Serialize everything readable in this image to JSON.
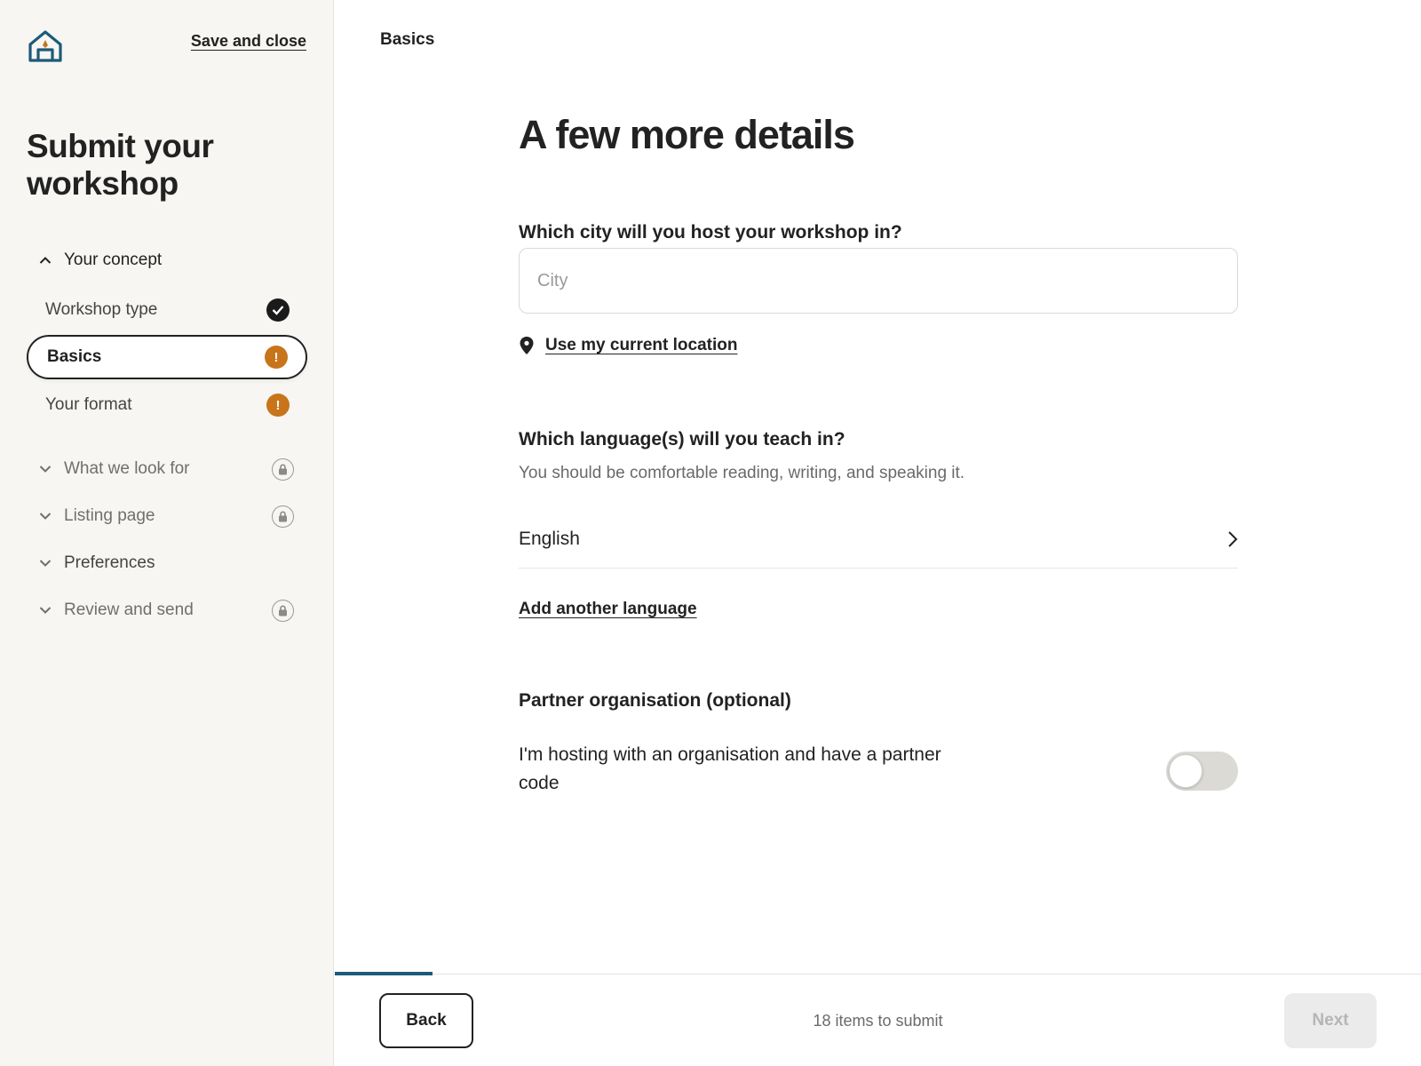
{
  "sidebar": {
    "logo_icon": "house-logo-icon",
    "save_close": "Save and close",
    "title": "Submit your workshop",
    "sections": [
      {
        "label": "Your concept",
        "state": "open"
      },
      {
        "label": "What we look for",
        "state": "locked"
      },
      {
        "label": "Listing page",
        "state": "locked"
      },
      {
        "label": "Preferences",
        "state": "collapsed"
      },
      {
        "label": "Review and send",
        "state": "locked"
      }
    ],
    "steps": [
      {
        "label": "Workshop type",
        "status": "complete"
      },
      {
        "label": "Basics",
        "status": "attention",
        "active": true
      },
      {
        "label": "Your format",
        "status": "attention"
      }
    ]
  },
  "header": {
    "breadcrumb": "Basics"
  },
  "main": {
    "title": "A few more details",
    "city": {
      "question": "Which city will you host your workshop in?",
      "placeholder": "City",
      "value": "",
      "use_location": "Use my current location"
    },
    "language": {
      "question": "Which language(s) will you teach in?",
      "hint": "You should be comfortable reading, writing, and speaking it.",
      "selected": "English",
      "add_another": "Add another language"
    },
    "partner": {
      "heading": "Partner organisation (optional)",
      "toggle_label": "I'm hosting with an organisation and have a partner code",
      "toggle_on": false
    }
  },
  "footer": {
    "back": "Back",
    "items_to_submit": "18 items to submit",
    "next": "Next",
    "progress_fraction": 0.09
  },
  "colors": {
    "accent": "#1d5a7a",
    "warning": "#c8741a",
    "complete": "#1a1a1a",
    "sidebar_bg": "#f7f6f2"
  }
}
